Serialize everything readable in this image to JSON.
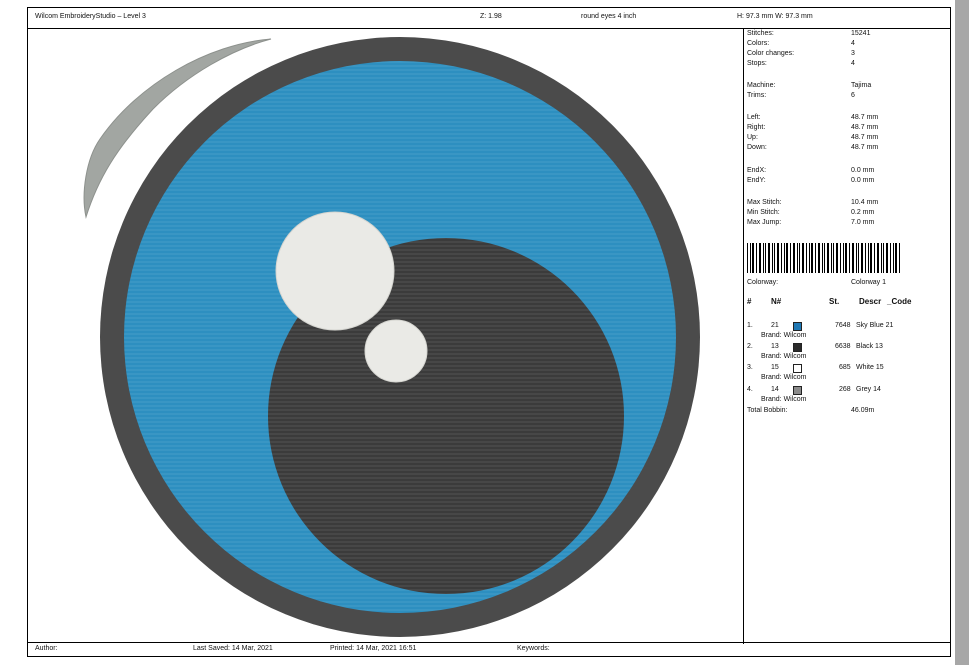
{
  "header": {
    "app_title": "Wilcom EmbroideryStudio – Level 3",
    "zoom": "Z: 1.98",
    "design_name": "round eyes 4 inch",
    "dimensions": "H: 97.3 mm   W: 97.3 mm"
  },
  "info": {
    "stitches_label": "Stitches:",
    "stitches": "15241",
    "colors_label": "Colors:",
    "colors": "4",
    "color_changes_label": "Color changes:",
    "color_changes": "3",
    "stops_label": "Stops:",
    "stops": "4",
    "machine_label": "Machine:",
    "machine": "Tajima",
    "trims_label": "Trims:",
    "trims": "6",
    "left_label": "Left:",
    "left": "48.7 mm",
    "right_label": "Right:",
    "right": "48.7 mm",
    "up_label": "Up:",
    "up": "48.7 mm",
    "down_label": "Down:",
    "down": "48.7 mm",
    "endx_label": "EndX:",
    "endx": "0.0 mm",
    "endy_label": "EndY:",
    "endy": "0.0 mm",
    "max_stitch_label": "Max Stitch:",
    "max_stitch": "10.4 mm",
    "min_stitch_label": "Min Stitch:",
    "min_stitch": "0.2 mm",
    "max_jump_label": "Max Jump:",
    "max_jump": "7.0 mm",
    "colorway_label": "Colorway:",
    "colorway": "Colorway 1"
  },
  "table": {
    "headers": {
      "num": "#",
      "n": "N#",
      "st": "St.",
      "descr": "Descr",
      "code": "_Code"
    },
    "rows": [
      {
        "idx": "1.",
        "n": "21",
        "st": "7648",
        "desc": "Sky Blue 21",
        "brand": "Brand: Wilcom",
        "color": "#1f78b4"
      },
      {
        "idx": "2.",
        "n": "13",
        "st": "6638",
        "desc": "Black 13",
        "brand": "Brand: Wilcom",
        "color": "#2b2b2b"
      },
      {
        "idx": "3.",
        "n": "15",
        "st": "685",
        "desc": "White 15",
        "brand": "Brand: Wilcom",
        "color": "#ffffff"
      },
      {
        "idx": "4.",
        "n": "14",
        "st": "268",
        "desc": "Grey 14",
        "brand": "Brand: Wilcom",
        "color": "#8a8a8a"
      }
    ],
    "total_bobbin_label": "Total Bobbin:",
    "total_bobbin": "46.09m"
  },
  "footer": {
    "author_label": "Author:",
    "last_saved": "Last Saved: 14 Mar, 2021",
    "printed": "Printed: 14 Mar, 2021 16:51",
    "keywords_label": "Keywords:"
  },
  "colors": {
    "sky_blue": "#2f8fbf",
    "black": "#3b3b3b",
    "outline": "#4a4a4a",
    "white": "#ececec",
    "grey": "#a3a6a3"
  }
}
